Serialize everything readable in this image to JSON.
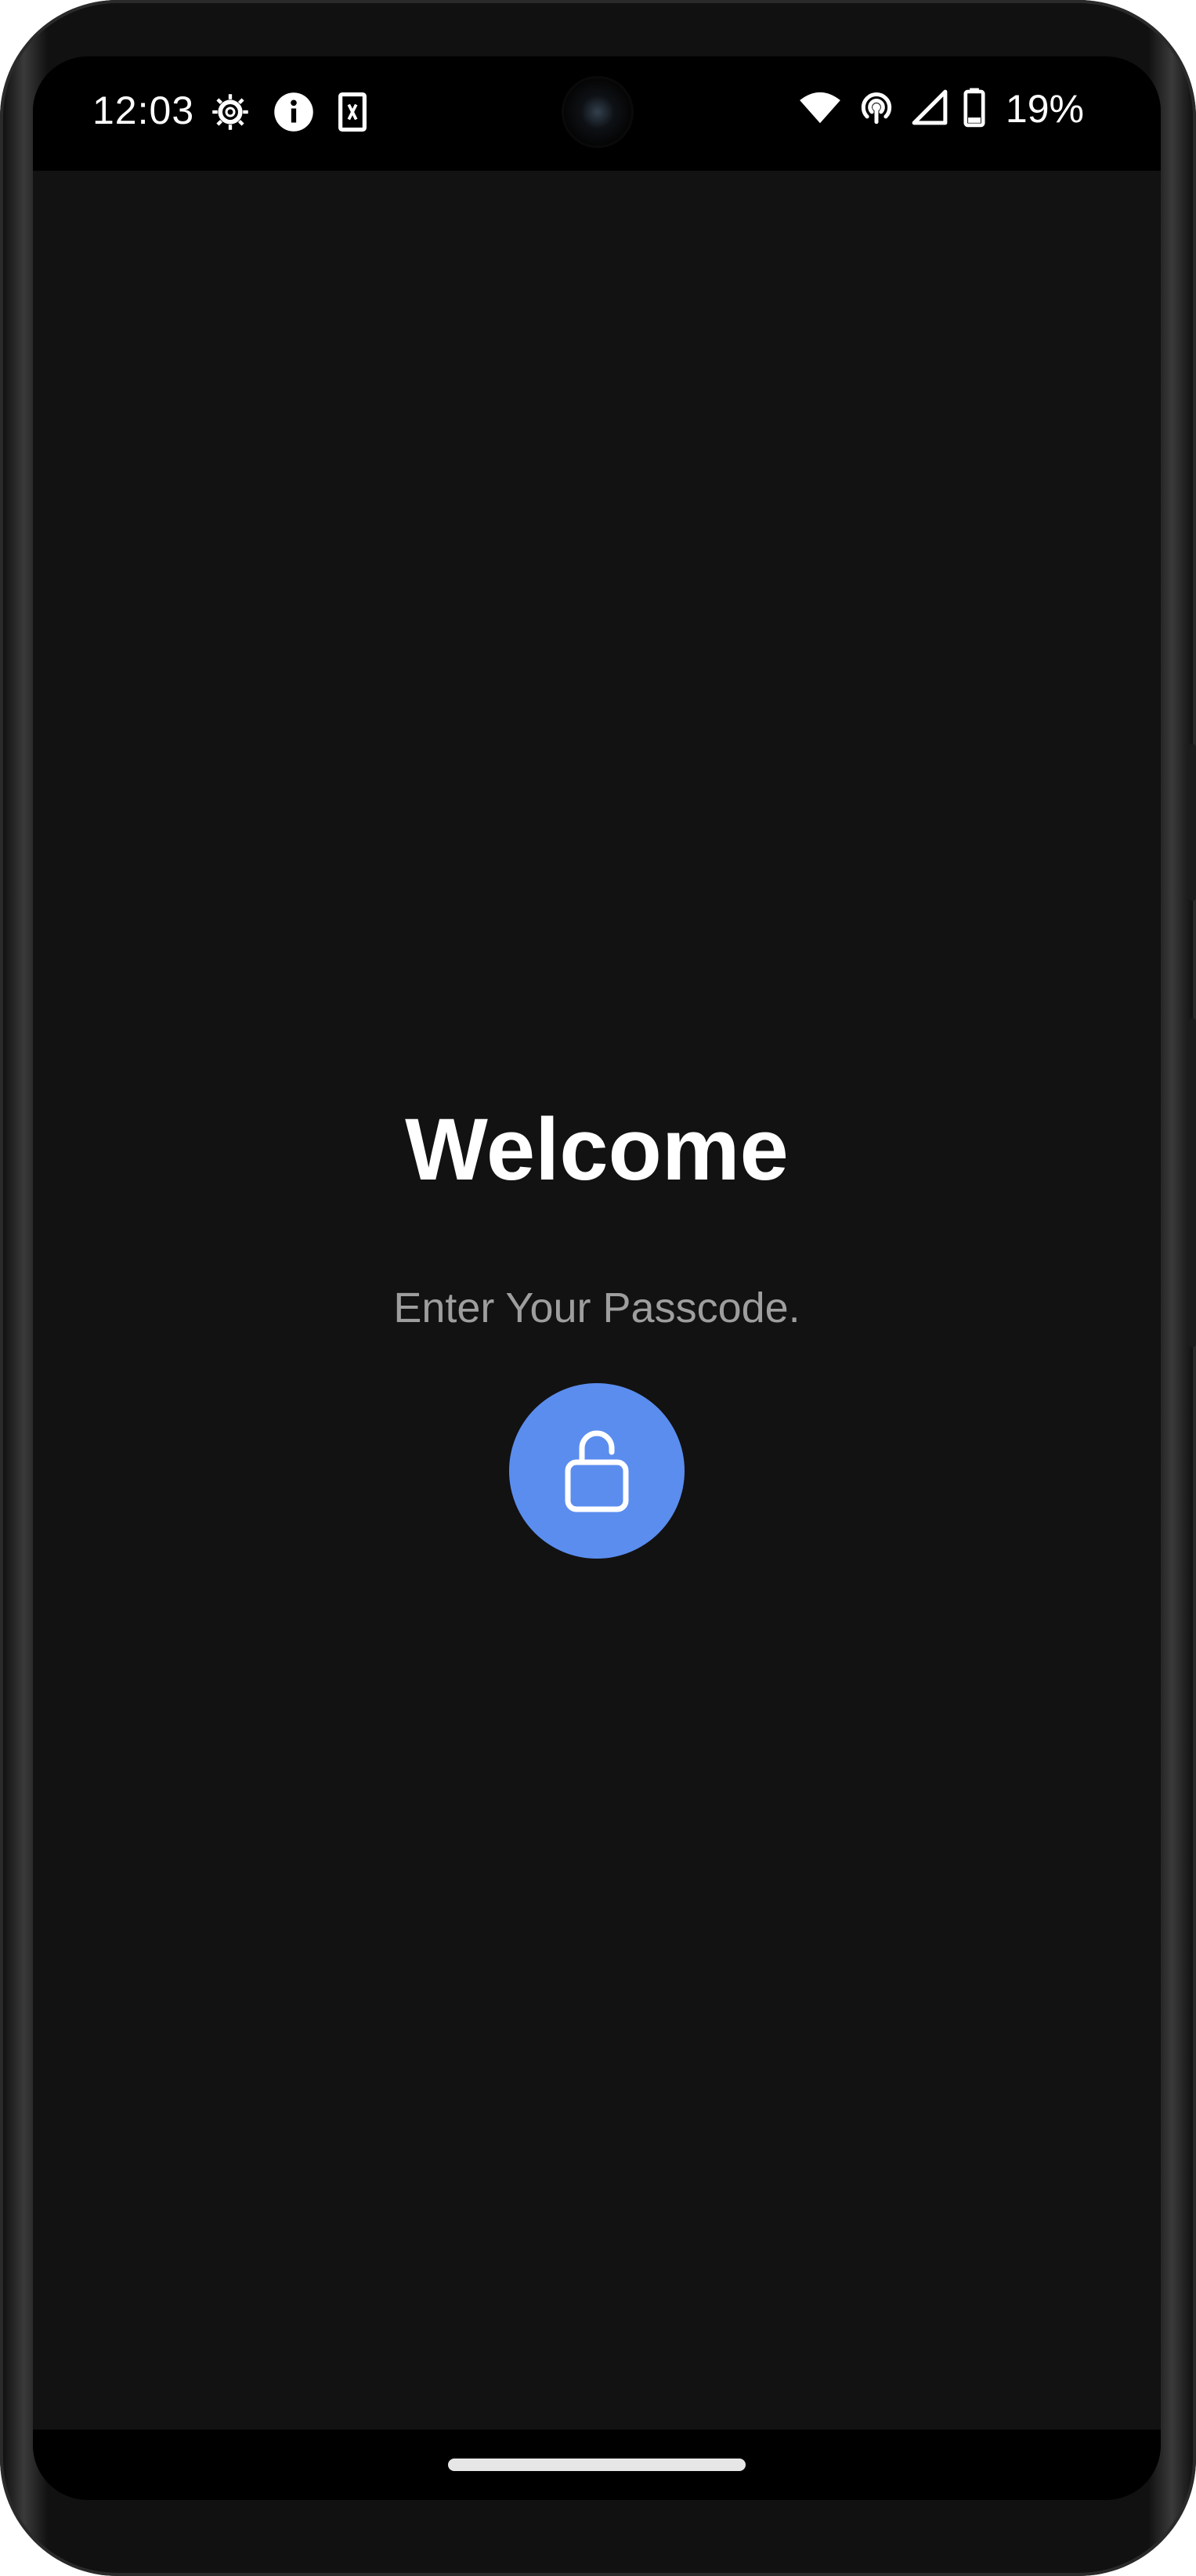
{
  "status_bar": {
    "time": "12:03",
    "left_icons": [
      "settings-gear-icon",
      "info-icon",
      "sim-card-icon"
    ],
    "right_icons": [
      "wifi-icon",
      "hotspot-icon",
      "cellular-signal-icon",
      "battery-icon"
    ],
    "battery_percent": "19%"
  },
  "main": {
    "title": "Welcome",
    "subtitle": "Enter Your Passcode.",
    "unlock_button": {
      "icon": "unlock-icon",
      "color": "#5b8def"
    }
  },
  "nav": {
    "handle": "home-gesture-handle"
  },
  "colors": {
    "background": "#121212",
    "accent": "#5b8def",
    "subtitle": "#9e9e9e"
  }
}
